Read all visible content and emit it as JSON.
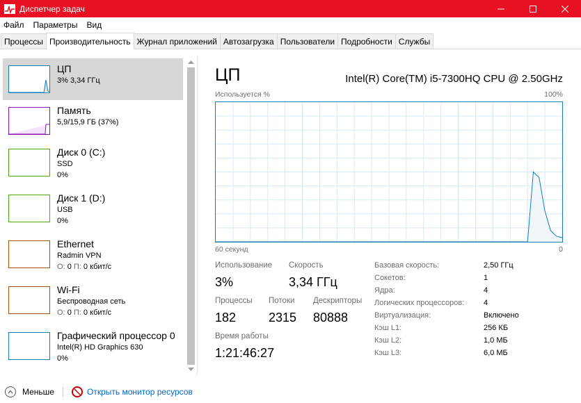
{
  "window": {
    "title": "Диспетчер задач",
    "accent": "#e81123"
  },
  "menu": {
    "items": [
      "Файл",
      "Параметры",
      "Вид"
    ]
  },
  "tabs": [
    "Процессы",
    "Производительность",
    "Журнал приложений",
    "Автозагрузка",
    "Пользователи",
    "Подробности",
    "Службы"
  ],
  "active_tab": "Производительность",
  "resources": [
    {
      "name": "ЦП",
      "line1": "3% 3,34 ГГц",
      "line2": "",
      "color": "#117dbb"
    },
    {
      "name": "Память",
      "line1": "5,9/15,9 ГБ (37%)",
      "line2": "",
      "color": "#8b12ae"
    },
    {
      "name": "Диск 0 (C:)",
      "line1": "SSD",
      "line2": "0%",
      "color": "#4da60c"
    },
    {
      "name": "Диск 1 (D:)",
      "line1": "USB",
      "line2": "0%",
      "color": "#4da60c"
    },
    {
      "name": "Ethernet",
      "line1": "Radmin VPN",
      "line2_label_o": "О:",
      "line2_val_o": "0",
      "line2_label_p": "П:",
      "line2_val_p": "0 кбит/с",
      "color": "#a74f01"
    },
    {
      "name": "Wi-Fi",
      "line1": "Беспроводная сеть",
      "line2_label_o": "О:",
      "line2_val_o": "0",
      "line2_label_p": "П:",
      "line2_val_p": "0 кбит/с",
      "color": "#a74f01"
    },
    {
      "name": "Графический процессор 0",
      "line1": "Intel(R) HD Graphics 630",
      "line2": "0%",
      "color": "#117dbb"
    }
  ],
  "cpu": {
    "title": "ЦП",
    "model": "Intel(R) Core(TM) i5-7300HQ CPU @ 2.50GHz",
    "graph_label_top_left": "Используется %",
    "graph_label_top_right": "100%",
    "graph_label_bottom_left": "60 секунд",
    "graph_label_bottom_right": "0",
    "usage_history_percent": [
      0,
      0,
      0,
      0,
      0,
      0,
      0,
      0,
      0,
      0,
      0,
      0,
      0,
      0,
      0,
      0,
      0,
      0,
      0,
      0,
      0,
      0,
      0,
      0,
      0,
      0,
      0,
      0,
      0,
      0,
      0,
      0,
      0,
      0,
      0,
      0,
      0,
      0,
      0,
      0,
      0,
      0,
      0,
      0,
      0,
      0,
      0,
      0,
      0,
      0,
      0,
      0,
      0,
      0,
      0,
      50,
      46,
      22,
      8,
      4,
      3
    ],
    "stats": {
      "usage_label": "Использование",
      "usage_value": "3%",
      "speed_label": "Скорость",
      "speed_value": "3,34 ГГц",
      "processes_label": "Процессы",
      "processes_value": "182",
      "threads_label": "Потоки",
      "threads_value": "2315",
      "handles_label": "Дескрипторы",
      "handles_value": "80888",
      "uptime_label": "Время работы",
      "uptime_value": "1:21:46:27"
    },
    "details": [
      {
        "label": "Базовая скорость:",
        "value": "2,50 ГГц"
      },
      {
        "label": "Сокетов:",
        "value": "1"
      },
      {
        "label": "Ядра:",
        "value": "4"
      },
      {
        "label": "Логических процессоров:",
        "value": "4"
      },
      {
        "label": "Виртуализация:",
        "value": "Включено"
      },
      {
        "label": "Кэш L1:",
        "value": "256 КБ"
      },
      {
        "label": "Кэш L2:",
        "value": "1,0 МБ"
      },
      {
        "label": "Кэш L3:",
        "value": "6,0 МБ"
      }
    ]
  },
  "bottom": {
    "less_label": "Меньше",
    "monitor_link": "Открыть монитор ресурсов"
  }
}
